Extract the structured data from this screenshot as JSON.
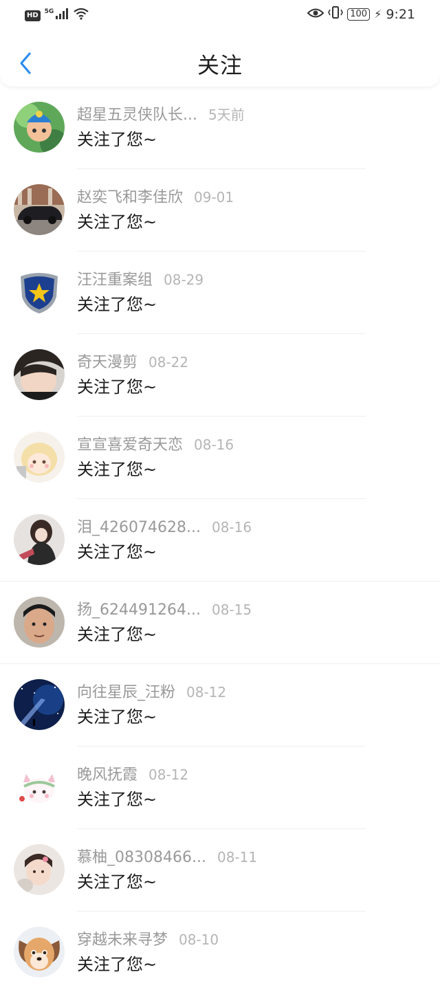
{
  "status_bar": {
    "hd": "HD",
    "network": "5G",
    "battery": "100",
    "time": "9:21"
  },
  "header": {
    "title": "关注",
    "back_icon": "chevron-left-icon"
  },
  "colors": {
    "accent": "#2d8cf0",
    "name_gray": "#999999",
    "time_gray": "#b5b5b5"
  },
  "notifications": [
    {
      "name": "超星五灵侠队长...",
      "time": "5天前",
      "message": "关注了您~"
    },
    {
      "name": "赵奕飞和李佳欣",
      "time": "09-01",
      "message": "关注了您~"
    },
    {
      "name": "汪汪重案组",
      "time": "08-29",
      "message": "关注了您~"
    },
    {
      "name": "奇天漫剪",
      "time": "08-22",
      "message": "关注了您~"
    },
    {
      "name": "宣宣喜爱奇天恋",
      "time": "08-16",
      "message": "关注了您~"
    },
    {
      "name": "泪_426074628...",
      "time": "08-16",
      "message": "关注了您~"
    },
    {
      "name": "扬_624491264...",
      "time": "08-15",
      "message": "关注了您~"
    },
    {
      "name": "向往星辰_汪粉",
      "time": "08-12",
      "message": "关注了您~"
    },
    {
      "name": "晚风抚霞",
      "time": "08-12",
      "message": "关注了您~"
    },
    {
      "name": "慕柚_08308466...",
      "time": "08-11",
      "message": "关注了您~"
    },
    {
      "name": "穿越未来寻梦",
      "time": "08-10",
      "message": "关注了您~"
    }
  ]
}
